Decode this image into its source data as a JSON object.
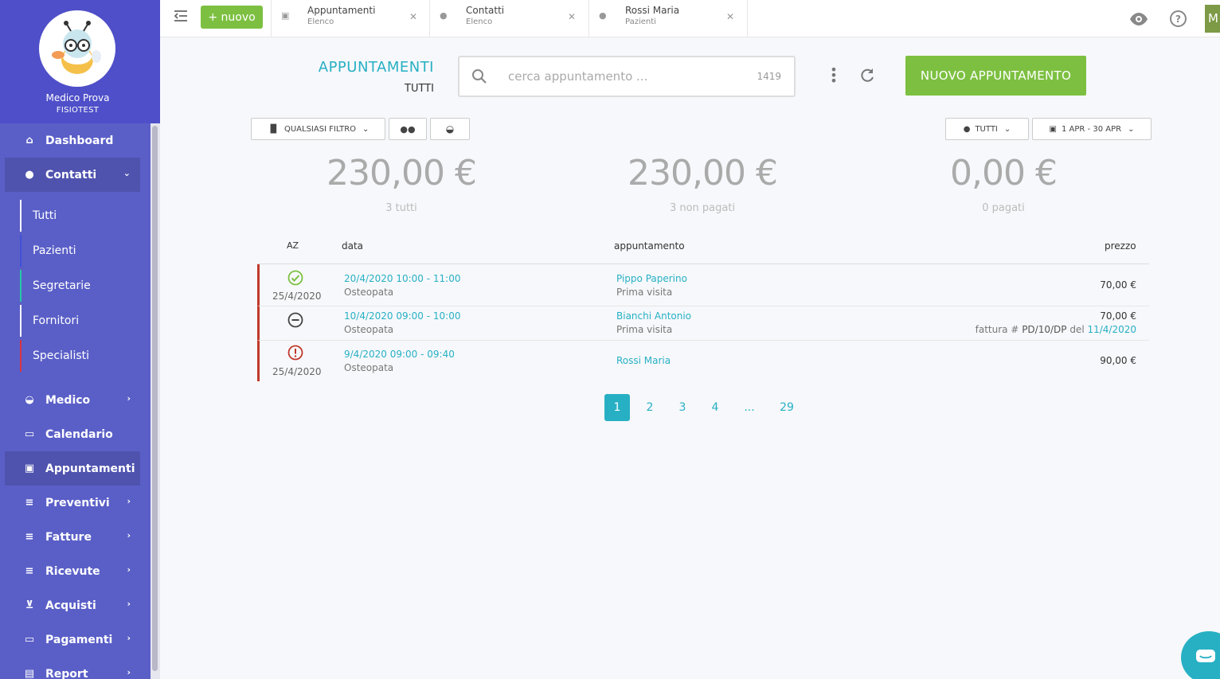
{
  "sidebar": {
    "user_name": "Medico Prova",
    "user_org": "FISIOTEST",
    "nav": [
      {
        "label": "Dashboard",
        "icon": "home-icon"
      },
      {
        "label": "Contatti",
        "icon": "person-icon"
      },
      {
        "label": "Medico",
        "icon": "basket-icon"
      },
      {
        "label": "Calendario",
        "icon": "calendar-icon"
      },
      {
        "label": "Appuntamenti",
        "icon": "calendar-event-icon"
      },
      {
        "label": "Preventivi",
        "icon": "playlist-add-icon"
      },
      {
        "label": "Fatture",
        "icon": "playlist-check-icon"
      },
      {
        "label": "Ricevute",
        "icon": "playlist-check-icon"
      },
      {
        "label": "Acquisti",
        "icon": "cart-icon"
      },
      {
        "label": "Pagamenti",
        "icon": "credit-card-icon"
      },
      {
        "label": "Report",
        "icon": "chart-icon"
      }
    ],
    "contatti_sub": [
      {
        "label": "Tutti",
        "color": "#ffffff"
      },
      {
        "label": "Pazienti",
        "color": "#3f51d6"
      },
      {
        "label": "Segretarie",
        "color": "#26c6a8"
      },
      {
        "label": "Fornitori",
        "color": "#ffffff"
      },
      {
        "label": "Specialisti",
        "color": "#d9343f"
      }
    ]
  },
  "topbar": {
    "new_button": "+ nuovo",
    "tabs": [
      {
        "title": "Appuntamenti",
        "sub": "Elenco",
        "icon": "calendar-icon"
      },
      {
        "title": "Contatti",
        "sub": "Elenco",
        "icon": "person-icon"
      },
      {
        "title": "Rossi Maria",
        "sub": "Pazienti",
        "icon": "person-icon"
      }
    ],
    "avatar_letter": "M"
  },
  "header": {
    "title": "APPUNTAMENTI",
    "subtitle": "TUTTI",
    "search_placeholder": "cerca appuntamento ...",
    "search_count": "1419",
    "new_appointment": "NUOVO APPUNTAMENTO"
  },
  "filters": {
    "any_filter": "QUALSIASI FILTRO",
    "user_filter": "TUTTI",
    "date_range": "1 APR - 30 APR"
  },
  "stats": [
    {
      "value": "230,00 €",
      "label": "3 tutti"
    },
    {
      "value": "230,00 €",
      "label": "3 non pagati"
    },
    {
      "value": "0,00 €",
      "label": "0 pagati"
    }
  ],
  "table": {
    "headers": {
      "sort": "AZ",
      "date": "data",
      "appointment": "appuntamento",
      "price": "prezzo"
    },
    "rows": [
      {
        "status": "check",
        "status_date": "25/4/2020",
        "date": "20/4/2020 10:00 - 11:00",
        "category": "Osteopata",
        "patient": "Pippo Paperino",
        "visit": "Prima visita",
        "price": "70,00 €",
        "invoice_prefix": "",
        "invoice_number": "",
        "invoice_mid": "",
        "invoice_date": ""
      },
      {
        "status": "minus",
        "status_date": "",
        "date": "10/4/2020 09:00 - 10:00",
        "category": "Osteopata",
        "patient": "Bianchi Antonio",
        "visit": "Prima visita",
        "price": "70,00 €",
        "invoice_prefix": "fattura # ",
        "invoice_number": "PD/10/DP",
        "invoice_mid": " del ",
        "invoice_date": "11/4/2020"
      },
      {
        "status": "alert",
        "status_date": "25/4/2020",
        "date": "9/4/2020 09:00 - 09:40",
        "category": "Osteopata",
        "patient": "Rossi Maria",
        "visit": "",
        "price": "90,00 €",
        "invoice_prefix": "",
        "invoice_number": "",
        "invoice_mid": "",
        "invoice_date": ""
      }
    ]
  },
  "pagination": [
    "1",
    "2",
    "3",
    "4",
    "...",
    "29"
  ],
  "colors": {
    "accent": "#27b0c4",
    "green": "#7dc041",
    "sidebar": "#5a5fc7",
    "danger": "#c0392b"
  }
}
